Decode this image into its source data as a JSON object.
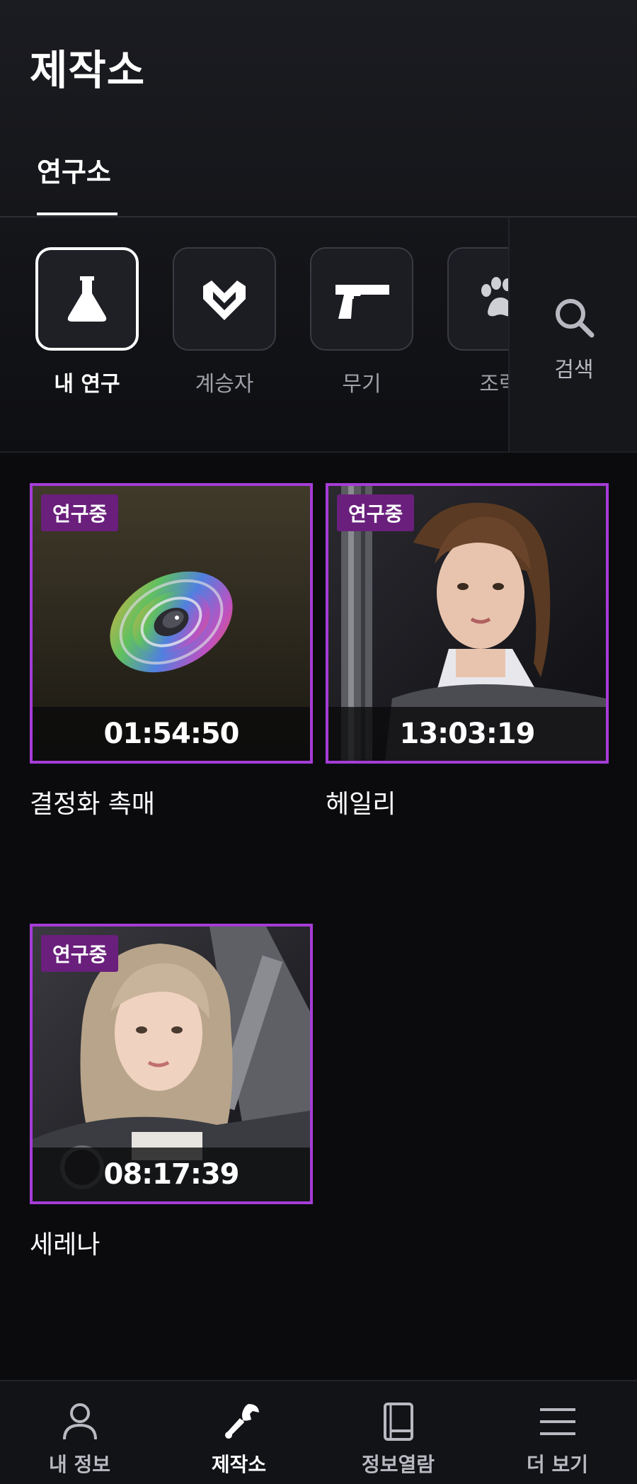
{
  "header": {
    "title": "제작소"
  },
  "tabs": [
    {
      "label": "연구소",
      "active": true
    }
  ],
  "categories": [
    {
      "label": "내 연구",
      "icon": "flask-icon",
      "active": true
    },
    {
      "label": "계승자",
      "icon": "chevron-emblem-icon",
      "active": false
    },
    {
      "label": "무기",
      "icon": "pistol-icon",
      "active": false
    },
    {
      "label": "조력",
      "icon": "paw-icon",
      "active": false
    }
  ],
  "search": {
    "label": "검색",
    "icon": "search-icon"
  },
  "research_items": [
    {
      "name": "결정화 촉매",
      "status": "연구중",
      "timer": "01:54:50"
    },
    {
      "name": "헤일리",
      "status": "연구중",
      "timer": "13:03:19"
    },
    {
      "name": "세레나",
      "status": "연구중",
      "timer": "08:17:39"
    }
  ],
  "bottom_nav": [
    {
      "label": "내 정보",
      "icon": "person-icon",
      "active": false
    },
    {
      "label": "제작소",
      "icon": "wrench-icon",
      "active": true
    },
    {
      "label": "정보열람",
      "icon": "book-icon",
      "active": false
    },
    {
      "label": "더 보기",
      "icon": "menu-icon",
      "active": false
    }
  ],
  "colors": {
    "accent_border": "#a63cd6",
    "badge_bg": "#6a1f7c",
    "background": "#0b0b0e"
  }
}
